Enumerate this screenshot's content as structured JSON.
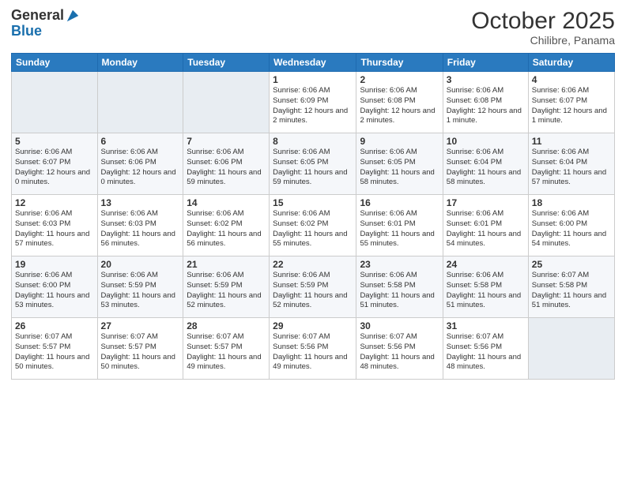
{
  "header": {
    "logo_general": "General",
    "logo_blue": "Blue",
    "month": "October 2025",
    "location": "Chilibre, Panama"
  },
  "weekdays": [
    "Sunday",
    "Monday",
    "Tuesday",
    "Wednesday",
    "Thursday",
    "Friday",
    "Saturday"
  ],
  "weeks": [
    [
      {
        "day": "",
        "info": ""
      },
      {
        "day": "",
        "info": ""
      },
      {
        "day": "",
        "info": ""
      },
      {
        "day": "1",
        "info": "Sunrise: 6:06 AM\nSunset: 6:09 PM\nDaylight: 12 hours and 2 minutes."
      },
      {
        "day": "2",
        "info": "Sunrise: 6:06 AM\nSunset: 6:08 PM\nDaylight: 12 hours and 2 minutes."
      },
      {
        "day": "3",
        "info": "Sunrise: 6:06 AM\nSunset: 6:08 PM\nDaylight: 12 hours and 1 minute."
      },
      {
        "day": "4",
        "info": "Sunrise: 6:06 AM\nSunset: 6:07 PM\nDaylight: 12 hours and 1 minute."
      }
    ],
    [
      {
        "day": "5",
        "info": "Sunrise: 6:06 AM\nSunset: 6:07 PM\nDaylight: 12 hours and 0 minutes."
      },
      {
        "day": "6",
        "info": "Sunrise: 6:06 AM\nSunset: 6:06 PM\nDaylight: 12 hours and 0 minutes."
      },
      {
        "day": "7",
        "info": "Sunrise: 6:06 AM\nSunset: 6:06 PM\nDaylight: 11 hours and 59 minutes."
      },
      {
        "day": "8",
        "info": "Sunrise: 6:06 AM\nSunset: 6:05 PM\nDaylight: 11 hours and 59 minutes."
      },
      {
        "day": "9",
        "info": "Sunrise: 6:06 AM\nSunset: 6:05 PM\nDaylight: 11 hours and 58 minutes."
      },
      {
        "day": "10",
        "info": "Sunrise: 6:06 AM\nSunset: 6:04 PM\nDaylight: 11 hours and 58 minutes."
      },
      {
        "day": "11",
        "info": "Sunrise: 6:06 AM\nSunset: 6:04 PM\nDaylight: 11 hours and 57 minutes."
      }
    ],
    [
      {
        "day": "12",
        "info": "Sunrise: 6:06 AM\nSunset: 6:03 PM\nDaylight: 11 hours and 57 minutes."
      },
      {
        "day": "13",
        "info": "Sunrise: 6:06 AM\nSunset: 6:03 PM\nDaylight: 11 hours and 56 minutes."
      },
      {
        "day": "14",
        "info": "Sunrise: 6:06 AM\nSunset: 6:02 PM\nDaylight: 11 hours and 56 minutes."
      },
      {
        "day": "15",
        "info": "Sunrise: 6:06 AM\nSunset: 6:02 PM\nDaylight: 11 hours and 55 minutes."
      },
      {
        "day": "16",
        "info": "Sunrise: 6:06 AM\nSunset: 6:01 PM\nDaylight: 11 hours and 55 minutes."
      },
      {
        "day": "17",
        "info": "Sunrise: 6:06 AM\nSunset: 6:01 PM\nDaylight: 11 hours and 54 minutes."
      },
      {
        "day": "18",
        "info": "Sunrise: 6:06 AM\nSunset: 6:00 PM\nDaylight: 11 hours and 54 minutes."
      }
    ],
    [
      {
        "day": "19",
        "info": "Sunrise: 6:06 AM\nSunset: 6:00 PM\nDaylight: 11 hours and 53 minutes."
      },
      {
        "day": "20",
        "info": "Sunrise: 6:06 AM\nSunset: 5:59 PM\nDaylight: 11 hours and 53 minutes."
      },
      {
        "day": "21",
        "info": "Sunrise: 6:06 AM\nSunset: 5:59 PM\nDaylight: 11 hours and 52 minutes."
      },
      {
        "day": "22",
        "info": "Sunrise: 6:06 AM\nSunset: 5:59 PM\nDaylight: 11 hours and 52 minutes."
      },
      {
        "day": "23",
        "info": "Sunrise: 6:06 AM\nSunset: 5:58 PM\nDaylight: 11 hours and 51 minutes."
      },
      {
        "day": "24",
        "info": "Sunrise: 6:06 AM\nSunset: 5:58 PM\nDaylight: 11 hours and 51 minutes."
      },
      {
        "day": "25",
        "info": "Sunrise: 6:07 AM\nSunset: 5:58 PM\nDaylight: 11 hours and 51 minutes."
      }
    ],
    [
      {
        "day": "26",
        "info": "Sunrise: 6:07 AM\nSunset: 5:57 PM\nDaylight: 11 hours and 50 minutes."
      },
      {
        "day": "27",
        "info": "Sunrise: 6:07 AM\nSunset: 5:57 PM\nDaylight: 11 hours and 50 minutes."
      },
      {
        "day": "28",
        "info": "Sunrise: 6:07 AM\nSunset: 5:57 PM\nDaylight: 11 hours and 49 minutes."
      },
      {
        "day": "29",
        "info": "Sunrise: 6:07 AM\nSunset: 5:56 PM\nDaylight: 11 hours and 49 minutes."
      },
      {
        "day": "30",
        "info": "Sunrise: 6:07 AM\nSunset: 5:56 PM\nDaylight: 11 hours and 48 minutes."
      },
      {
        "day": "31",
        "info": "Sunrise: 6:07 AM\nSunset: 5:56 PM\nDaylight: 11 hours and 48 minutes."
      },
      {
        "day": "",
        "info": ""
      }
    ]
  ]
}
